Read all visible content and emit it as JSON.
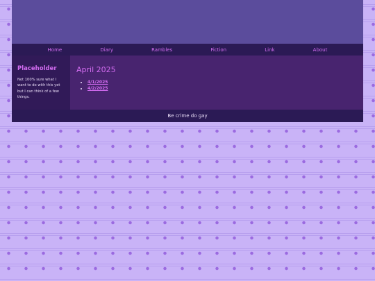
{
  "nav": {
    "items": [
      "Home",
      "Diary",
      "Rambles",
      "Fiction",
      "Link",
      "About"
    ]
  },
  "sidebar": {
    "title": "Placeholder",
    "text": "Not 100% sure what I want to do with this yet but I can think of a few things."
  },
  "content": {
    "title": "April 2025",
    "entries": [
      "4/1/2025",
      "4/2/2025"
    ]
  },
  "footer": {
    "text": "Be crime do gay"
  },
  "colors": {
    "accent": "#d36cf1",
    "banner": "#5b4c9c",
    "nav_bg": "#2b1a55",
    "content_bg": "#48246f",
    "sidebar_bg": "#311a58",
    "page_bg": "#c9b3f7"
  }
}
